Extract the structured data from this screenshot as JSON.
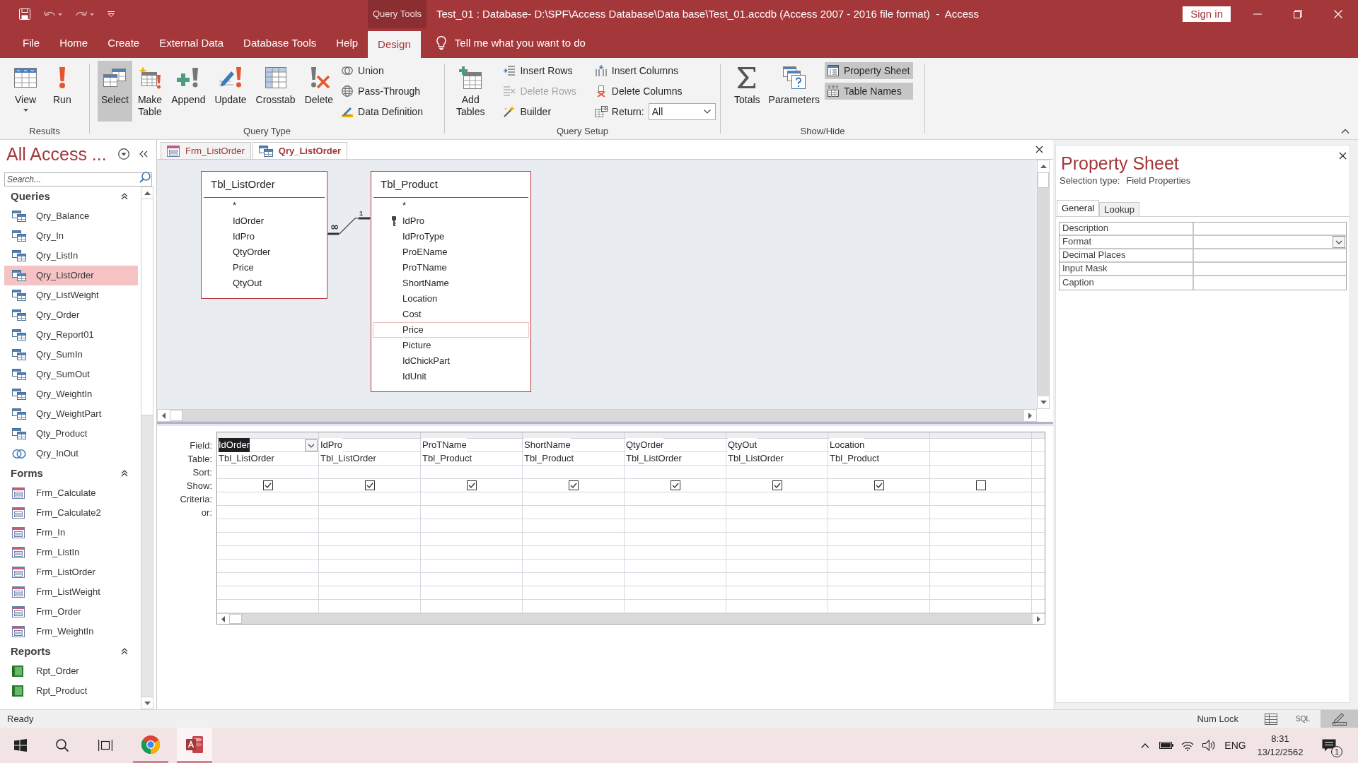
{
  "title_bar": {
    "context_tab": "Query Tools",
    "title": "Test_01 : Database- D:\\SPF\\Access Database\\Data base\\Test_01.accdb (Access 2007 - 2016 file format)  -  Access",
    "sign_in": "Sign in"
  },
  "ribbon_tabs": [
    {
      "label": "File",
      "selected": false
    },
    {
      "label": "Home",
      "selected": false
    },
    {
      "label": "Create",
      "selected": false
    },
    {
      "label": "External Data",
      "selected": false
    },
    {
      "label": "Database Tools",
      "selected": false
    },
    {
      "label": "Help",
      "selected": false
    },
    {
      "label": "Design",
      "selected": true
    }
  ],
  "tell_me": "Tell me what you want to do",
  "ribbon_groups": [
    {
      "label": "Results",
      "commands": [
        {
          "kind": "menu",
          "label": "View",
          "selected": false,
          "disabled": false
        },
        {
          "kind": "large",
          "label": "Run",
          "selected": false,
          "disabled": false
        }
      ]
    },
    {
      "label": "Query Type",
      "commands": [
        {
          "kind": "large",
          "label": "Select",
          "selected": true,
          "disabled": false
        },
        {
          "kind": "large",
          "label": "Make Table",
          "selected": false,
          "disabled": false
        },
        {
          "kind": "large",
          "label": "Append",
          "selected": false,
          "disabled": false
        },
        {
          "kind": "large",
          "label": "Update",
          "selected": false,
          "disabled": false
        },
        {
          "kind": "large",
          "label": "Crosstab",
          "selected": false,
          "disabled": false
        },
        {
          "kind": "large",
          "label": "Delete",
          "selected": false,
          "disabled": false
        },
        {
          "kind": "small",
          "label": "Union",
          "selected": false,
          "disabled": false
        },
        {
          "kind": "small",
          "label": "Pass-Through",
          "selected": false,
          "disabled": false
        },
        {
          "kind": "small",
          "label": "Data Definition",
          "selected": false,
          "disabled": false
        }
      ]
    },
    {
      "label": "Query Setup",
      "commands": [
        {
          "kind": "large",
          "label": "Add Tables",
          "selected": false,
          "disabled": false
        },
        {
          "kind": "small",
          "label": "Insert Rows",
          "selected": false,
          "disabled": false
        },
        {
          "kind": "small",
          "label": "Delete Rows",
          "selected": false,
          "disabled": true
        },
        {
          "kind": "small",
          "label": "Builder",
          "selected": false,
          "disabled": false
        },
        {
          "kind": "small",
          "label": "Insert Columns",
          "selected": false,
          "disabled": false
        },
        {
          "kind": "small",
          "label": "Delete Columns",
          "selected": false,
          "disabled": false
        },
        {
          "kind": "dropdown",
          "label": "Return:",
          "value": "All",
          "selected": false,
          "disabled": false
        }
      ]
    },
    {
      "label": "Show/Hide",
      "commands": [
        {
          "kind": "large",
          "label": "Totals",
          "selected": false,
          "disabled": false
        },
        {
          "kind": "large",
          "label": "Parameters",
          "selected": false,
          "disabled": false
        },
        {
          "kind": "small",
          "label": "Property Sheet",
          "selected": true,
          "disabled": false
        },
        {
          "kind": "small",
          "label": "Table Names",
          "selected": true,
          "disabled": false
        }
      ]
    }
  ],
  "nav": {
    "title": "All Access ...",
    "search": {
      "placeholder": "Search..."
    },
    "groups": [
      {
        "label": "Queries",
        "expanded": true,
        "items": [
          {
            "label": "Qry_Balance",
            "kind": "query",
            "selected": false
          },
          {
            "label": "Qry_In",
            "kind": "query",
            "selected": false
          },
          {
            "label": "Qry_ListIn",
            "kind": "query",
            "selected": false
          },
          {
            "label": "Qry_ListOrder",
            "kind": "query",
            "selected": true
          },
          {
            "label": "Qry_ListWeight",
            "kind": "query",
            "selected": false
          },
          {
            "label": "Qry_Order",
            "kind": "query",
            "selected": false
          },
          {
            "label": "Qry_Report01",
            "kind": "query",
            "selected": false
          },
          {
            "label": "Qry_SumIn",
            "kind": "query",
            "selected": false
          },
          {
            "label": "Qry_SumOut",
            "kind": "query",
            "selected": false
          },
          {
            "label": "Qry_WeightIn",
            "kind": "query",
            "selected": false
          },
          {
            "label": "Qry_WeightPart",
            "kind": "query",
            "selected": false
          },
          {
            "label": "Qty_Product",
            "kind": "query",
            "selected": false
          },
          {
            "label": "Qry_InOut",
            "kind": "union",
            "selected": false
          }
        ]
      },
      {
        "label": "Forms",
        "expanded": true,
        "items": [
          {
            "label": "Frm_Calculate",
            "kind": "form",
            "selected": false
          },
          {
            "label": "Frm_Calculate2",
            "kind": "form",
            "selected": false
          },
          {
            "label": "Frm_In",
            "kind": "form",
            "selected": false
          },
          {
            "label": "Frm_ListIn",
            "kind": "form",
            "selected": false
          },
          {
            "label": "Frm_ListOrder",
            "kind": "form",
            "selected": false
          },
          {
            "label": "Frm_ListWeight",
            "kind": "form",
            "selected": false
          },
          {
            "label": "Frm_Order",
            "kind": "form",
            "selected": false
          },
          {
            "label": "Frm_WeightIn",
            "kind": "form",
            "selected": false
          }
        ]
      },
      {
        "label": "Reports",
        "expanded": true,
        "items": [
          {
            "label": "Rpt_Order",
            "kind": "report",
            "selected": false
          },
          {
            "label": "Rpt_Product",
            "kind": "report",
            "selected": false
          }
        ]
      }
    ]
  },
  "document": {
    "tabs": [
      {
        "label": "Frm_ListOrder",
        "kind": "form",
        "selected": false
      },
      {
        "label": "Qry_ListOrder",
        "kind": "query",
        "selected": true
      }
    ],
    "tables": [
      {
        "name": "Tbl_ListOrder",
        "fields": [
          {
            "name": "*",
            "key": false,
            "selected": false
          },
          {
            "name": "IdOrder",
            "key": false,
            "selected": false
          },
          {
            "name": "IdPro",
            "key": false,
            "selected": false
          },
          {
            "name": "QtyOrder",
            "key": false,
            "selected": false
          },
          {
            "name": "Price",
            "key": false,
            "selected": false
          },
          {
            "name": "QtyOut",
            "key": false,
            "selected": false
          }
        ]
      },
      {
        "name": "Tbl_Product",
        "fields": [
          {
            "name": "*",
            "key": false,
            "selected": false
          },
          {
            "name": "IdPro",
            "key": true,
            "selected": false
          },
          {
            "name": "IdProType",
            "key": false,
            "selected": false
          },
          {
            "name": "ProEName",
            "key": false,
            "selected": false
          },
          {
            "name": "ProTName",
            "key": false,
            "selected": false
          },
          {
            "name": "ShortName",
            "key": false,
            "selected": false
          },
          {
            "name": "Location",
            "key": false,
            "selected": false
          },
          {
            "name": "Cost",
            "key": false,
            "selected": false
          },
          {
            "name": "Price",
            "key": false,
            "selected": true
          },
          {
            "name": "Picture",
            "key": false,
            "selected": false
          },
          {
            "name": "IdChickPart",
            "key": false,
            "selected": false
          },
          {
            "name": "IdUnit",
            "key": false,
            "selected": false
          }
        ]
      }
    ],
    "join": {
      "many_mark": "∞",
      "one_mark": "1"
    },
    "grid": {
      "row_labels": [
        "Field:",
        "Table:",
        "Sort:",
        "Show:",
        "Criteria:",
        "or:"
      ],
      "columns": [
        {
          "field": "IdOrder",
          "table": "Tbl_ListOrder",
          "show": true,
          "selected": true
        },
        {
          "field": "IdPro",
          "table": "Tbl_ListOrder",
          "show": true,
          "selected": false
        },
        {
          "field": "ProTName",
          "table": "Tbl_Product",
          "show": true,
          "selected": false
        },
        {
          "field": "ShortName",
          "table": "Tbl_Product",
          "show": true,
          "selected": false
        },
        {
          "field": "QtyOrder",
          "table": "Tbl_ListOrder",
          "show": true,
          "selected": false
        },
        {
          "field": "QtyOut",
          "table": "Tbl_ListOrder",
          "show": true,
          "selected": false
        },
        {
          "field": "Location",
          "table": "Tbl_Product",
          "show": true,
          "selected": false
        },
        {
          "show": false,
          "selected": false
        }
      ]
    }
  },
  "property_sheet": {
    "title": "Property Sheet",
    "selection_type_label": "Selection type:",
    "selection_type": "Field Properties",
    "tabs": [
      {
        "label": "General",
        "selected": true
      },
      {
        "label": "Lookup",
        "selected": false
      }
    ],
    "properties": [
      {
        "label": "Description",
        "kind": "text"
      },
      {
        "label": "Format",
        "kind": "dropdown"
      },
      {
        "label": "Decimal Places",
        "kind": "text"
      },
      {
        "label": "Input Mask",
        "kind": "text"
      },
      {
        "label": "Caption",
        "kind": "text"
      }
    ]
  },
  "status_bar": {
    "status": "Ready",
    "indicator": "Num Lock",
    "views": [
      {
        "kind": "datasheet",
        "selected": false
      },
      {
        "kind": "sql",
        "label": "SQL",
        "selected": false
      },
      {
        "kind": "design",
        "selected": true
      }
    ]
  },
  "taskbar": {
    "apps": [
      {
        "kind": "browser",
        "selected": false
      },
      {
        "kind": "database",
        "selected": true
      }
    ],
    "language": "ENG",
    "time": "8:31",
    "date": "13/12/2562",
    "notifications": "1"
  }
}
